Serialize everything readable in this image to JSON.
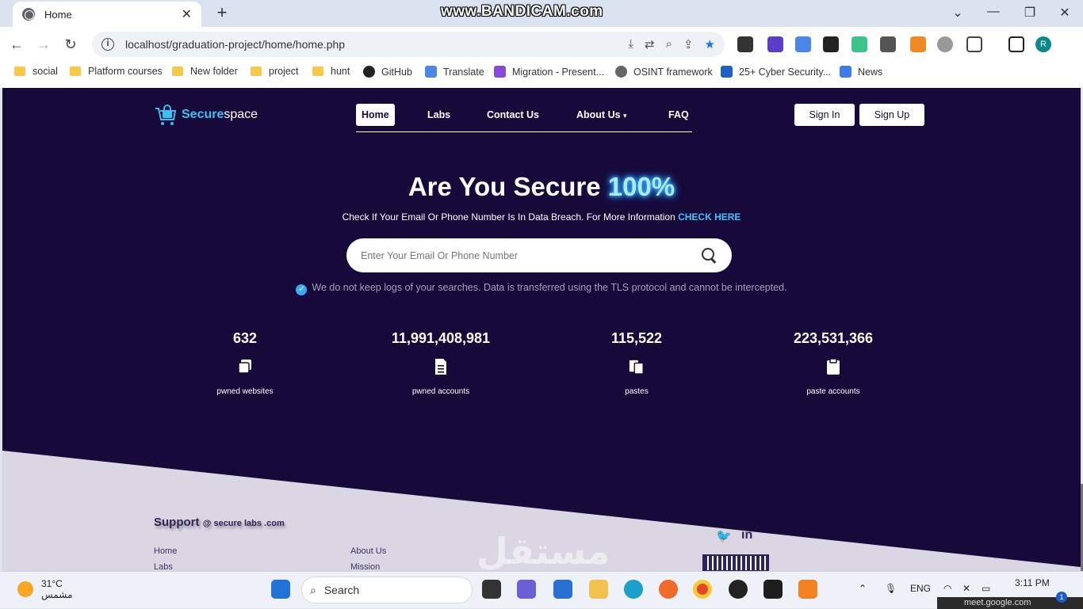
{
  "browser": {
    "tab_title": "Home",
    "close_symbol": "✕",
    "newtab_symbol": "+",
    "recorder_watermark": "www.BANDICAM.com",
    "url": "localhost/graduation-project/home/home.php",
    "profile_initial": "R"
  },
  "bookmarks": [
    {
      "label": "social",
      "icon": "folder-icon"
    },
    {
      "label": "Platform courses",
      "icon": "folder-icon"
    },
    {
      "label": "New folder",
      "icon": "folder-icon"
    },
    {
      "label": "project",
      "icon": "folder-icon"
    },
    {
      "label": "hunt",
      "icon": "folder-icon"
    },
    {
      "label": "GitHub",
      "icon": "github-icon"
    },
    {
      "label": "Translate",
      "icon": "translate-icon"
    },
    {
      "label": "Migration - Present...",
      "icon": "migration-icon"
    },
    {
      "label": "OSINT framework",
      "icon": "osint-icon"
    },
    {
      "label": "25+ Cyber Security...",
      "icon": "ct-icon"
    },
    {
      "label": "News",
      "icon": "news-icon"
    }
  ],
  "site": {
    "logo_part1": "Secure",
    "logo_part2": "space",
    "nav": [
      "Home",
      "Labs",
      "Contact Us",
      "About Us",
      "FAQ"
    ],
    "about_caret": "▾",
    "signin": "Sign In",
    "signup": "Sign Up",
    "hero_title": "Are You Secure",
    "hero_highlight": "100%",
    "hero_sub": "Check If Your Email Or Phone Number Is In Data Breach. For More Information",
    "hero_link": "CHECK HERE",
    "search_placeholder": "Enter Your Email Or Phone Number",
    "privacy_note": "We do not keep logs of your searches. Data is transferred using the TLS protocol and cannot be intercepted.",
    "stats": [
      {
        "value": "632",
        "label": "pwned websites",
        "icon": "websites-icon"
      },
      {
        "value": "11,991,408,981",
        "label": "pwned accounts",
        "icon": "accounts-icon"
      },
      {
        "value": "115,522",
        "label": "pastes",
        "icon": "pastes-icon"
      },
      {
        "value": "223,531,366",
        "label": "paste accounts",
        "icon": "clipboard-icon"
      }
    ],
    "footer": {
      "support_title": "Support",
      "support_email": "@ secure labs .com",
      "col1": [
        "Home",
        "Labs"
      ],
      "col2": [
        "About Us",
        "Mission"
      ],
      "twitter": "🐦",
      "linkedin": "in"
    },
    "center_watermark": "مستقل"
  },
  "taskbar": {
    "temp": "31°C",
    "condition": "مشمس",
    "search_label": "Search",
    "lang": "ENG",
    "time": "3:11 PM",
    "toast": "meet.google.com",
    "badge": "1"
  }
}
